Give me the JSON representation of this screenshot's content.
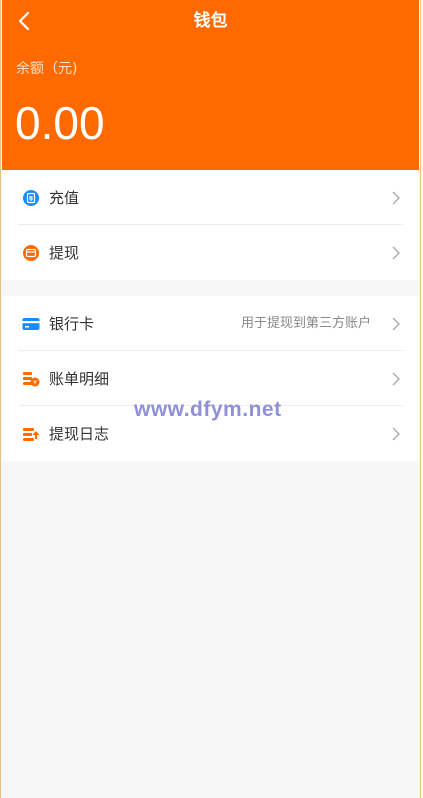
{
  "header": {
    "title": "钱包",
    "balance_label": "余额（元)",
    "balance_value": "0.00",
    "background": "#ff6a00"
  },
  "menu_group_1": [
    {
      "label": "充值",
      "icon": "recharge-icon",
      "icon_color": "#1a8cff"
    },
    {
      "label": "提现",
      "icon": "withdraw-icon",
      "icon_color": "#ff6a00"
    }
  ],
  "menu_group_2": [
    {
      "label": "银行卡",
      "hint": "用于提现到第三方账户",
      "icon": "bank-card-icon",
      "icon_color": "#1a8cff"
    },
    {
      "label": "账单明细",
      "icon": "bill-detail-icon",
      "icon_color": "#ff6a00"
    },
    {
      "label": "提现日志",
      "icon": "withdraw-log-icon",
      "icon_color": "#ff6a00"
    }
  ],
  "watermark": "www.dfym.net"
}
